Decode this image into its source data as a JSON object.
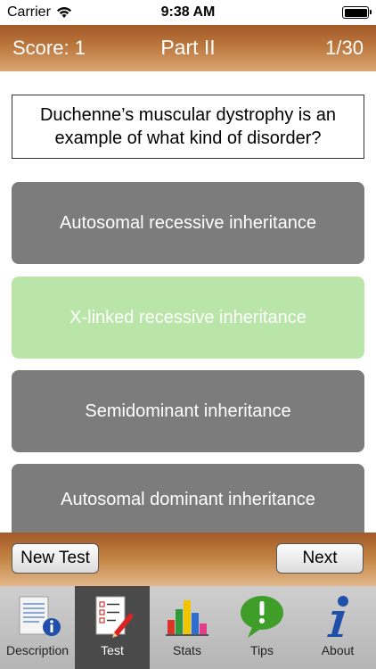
{
  "status": {
    "carrier": "Carrier",
    "time": "9:38 AM"
  },
  "header": {
    "score": "Score: 1",
    "title": "Part II",
    "progress": "1/30"
  },
  "question": {
    "text": "Duchenne’s muscular dystrophy is an example of what kind of disorder?"
  },
  "answers": [
    {
      "label": "Autosomal recessive inheritance",
      "state": "default"
    },
    {
      "label": "X-linked recessive inheritance",
      "state": "correct"
    },
    {
      "label": "Semidominant inheritance",
      "state": "default"
    },
    {
      "label": "Autosomal dominant inheritance",
      "state": "default"
    }
  ],
  "toolbar": {
    "new_test_label": "New Test",
    "next_label": "Next"
  },
  "tabs": [
    {
      "label": "Description",
      "icon": "description-document-icon"
    },
    {
      "label": "Test",
      "icon": "test-checklist-icon",
      "active": true
    },
    {
      "label": "Stats",
      "icon": "stats-bar-chart-icon"
    },
    {
      "label": "Tips",
      "icon": "tips-speech-bubble-icon"
    },
    {
      "label": "About",
      "icon": "about-info-icon"
    }
  ],
  "colors": {
    "header": "#b8733a",
    "answer_default": "#7c7c7c",
    "answer_correct": "#b9e6a8",
    "tab_active": "#4a4a4a"
  }
}
